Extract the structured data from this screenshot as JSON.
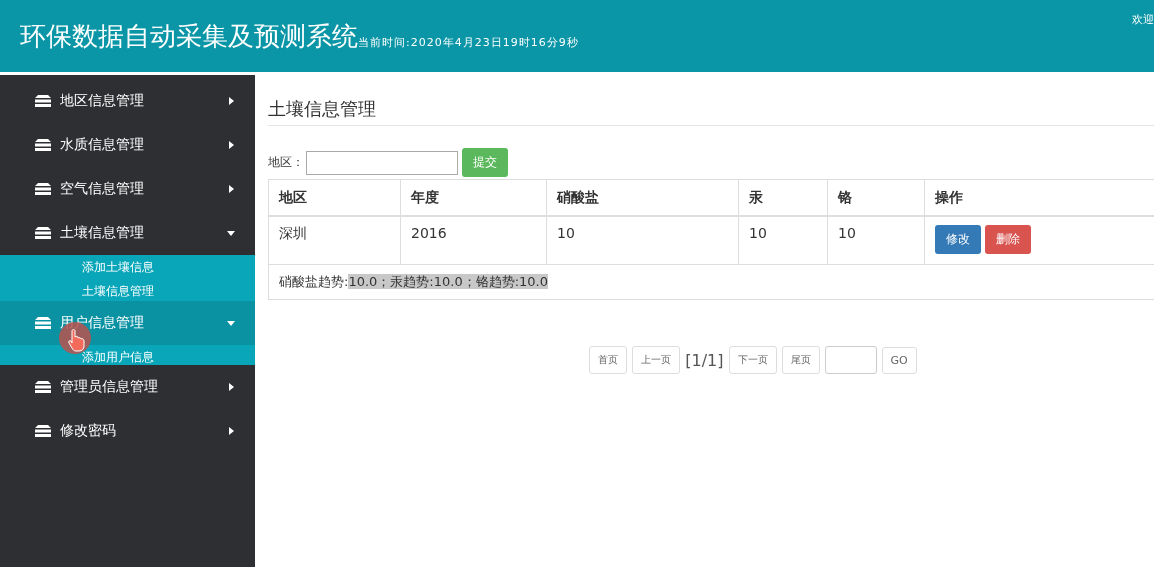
{
  "header": {
    "title": "环保数据自动采集及预测系统",
    "time": "当前时间:2020年4月23日19时16分9秒",
    "welcome": "欢迎"
  },
  "sidebar": {
    "items": [
      {
        "label": "地区信息管理",
        "expanded": false,
        "selected": false
      },
      {
        "label": "水质信息管理",
        "expanded": false,
        "selected": false
      },
      {
        "label": "空气信息管理",
        "expanded": false,
        "selected": false
      },
      {
        "label": "土壤信息管理",
        "expanded": true,
        "selected": false,
        "children": [
          {
            "label": "添加土壤信息"
          },
          {
            "label": "土壤信息管理"
          }
        ]
      },
      {
        "label": "用户信息管理",
        "expanded": true,
        "selected": true,
        "children": [
          {
            "label": "添加用户信息"
          }
        ]
      },
      {
        "label": "管理员信息管理",
        "expanded": false,
        "selected": false
      },
      {
        "label": "修改密码",
        "expanded": false,
        "selected": false
      }
    ]
  },
  "page": {
    "title": "土壤信息管理",
    "filter": {
      "label": "地区：",
      "button": "提交"
    },
    "table": {
      "columns": [
        "地区",
        "年度",
        "硝酸盐",
        "汞",
        "铬",
        "操作"
      ],
      "rows": [
        {
          "cells": [
            "深圳",
            "2016",
            "10",
            "10",
            "10"
          ],
          "actions": [
            {
              "label": "修改",
              "kind": "edit"
            },
            {
              "label": "删除",
              "kind": "delete"
            }
          ]
        }
      ],
      "trend": {
        "label": "硝酸盐趋势:",
        "highlight": "10.0；汞趋势:10.0；铬趋势:10.0"
      }
    },
    "pager": {
      "first": "首页",
      "prev": "上一页",
      "info": "[1/1]",
      "next": "下一页",
      "last": "尾页",
      "go": "GO"
    }
  }
}
